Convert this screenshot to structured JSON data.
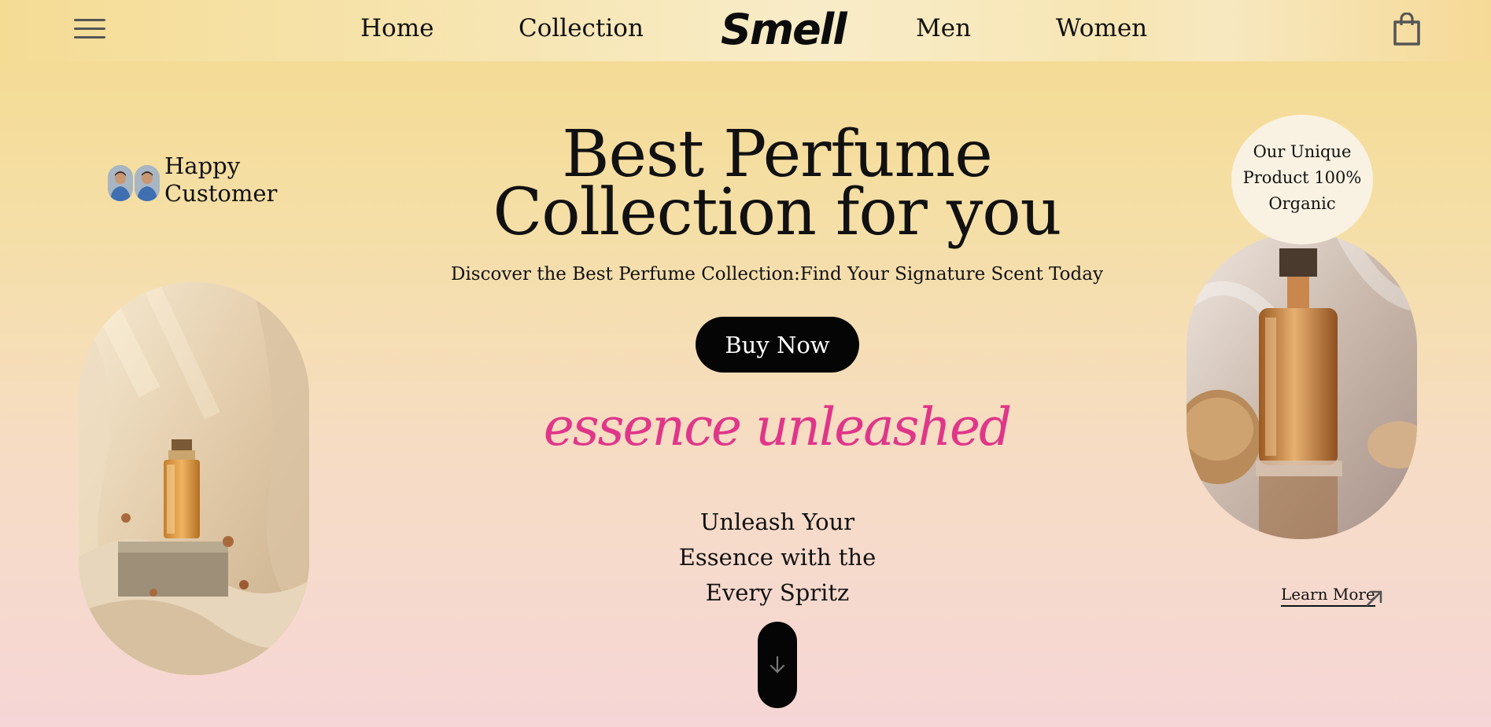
{
  "nav": {
    "links": [
      "Home",
      "Collection",
      "Men",
      "Women"
    ],
    "logo": "Smell",
    "menu_icon": "hamburger-menu-icon",
    "cart_icon": "shopping-bag-icon"
  },
  "happy_customer": {
    "line1": "Happy",
    "line2": "Customer"
  },
  "hero": {
    "title_line1": "Best Perfume",
    "title_line2": "Collection for you",
    "subtitle": "Discover the Best Perfume Collection:Find Your Signature Scent Today",
    "buy_label": "Buy Now",
    "tagline": "essence unleashed",
    "unleash_line1": "Unleash Your",
    "unleash_line2": "Essence with the",
    "unleash_line3": "Every Spritz",
    "scroll_icon": "arrow-down-icon"
  },
  "badge": {
    "line1": "Our Unique",
    "line2": "Product 100%",
    "line3": "Organic"
  },
  "learn_more": {
    "label": "Learn More",
    "icon": "arrow-up-right-icon"
  },
  "colors": {
    "accent_pink": "#e0368a",
    "button_black": "#050505"
  }
}
